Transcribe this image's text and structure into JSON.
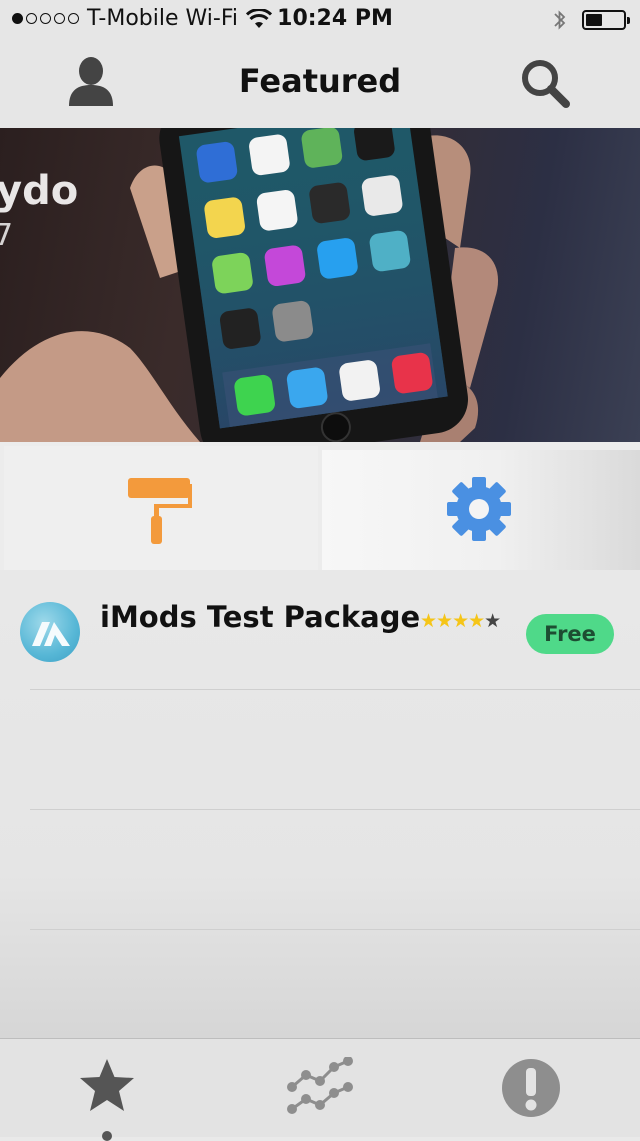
{
  "status_bar": {
    "carrier": "T-Mobile Wi-Fi",
    "time": "10:24 PM",
    "signal_bars_filled": 1,
    "signal_bars_total": 5,
    "battery_level": 0.4
  },
  "nav": {
    "title": "Featured",
    "left_icon": "profile-icon",
    "right_icon": "search-icon"
  },
  "banner": {
    "text_line1": "ydo",
    "text_line2": "7"
  },
  "categories": [
    {
      "icon": "paint-roller-icon",
      "color": "#f39a3c",
      "selected": false
    },
    {
      "icon": "gear-icon",
      "color": "#4a90e2",
      "selected": true
    }
  ],
  "packages": [
    {
      "name": "iMods Test Package",
      "rating": 4,
      "max_rating": 5,
      "price": "Free"
    }
  ],
  "tabbar": {
    "items": [
      {
        "icon": "star-icon",
        "selected": true
      },
      {
        "icon": "trending-icon",
        "selected": false
      },
      {
        "icon": "alert-icon",
        "selected": false
      }
    ]
  },
  "colors": {
    "accent_orange": "#f39a3c",
    "accent_blue": "#4a90e2",
    "price_green": "#4fd989",
    "star_yellow": "#f5c518"
  }
}
